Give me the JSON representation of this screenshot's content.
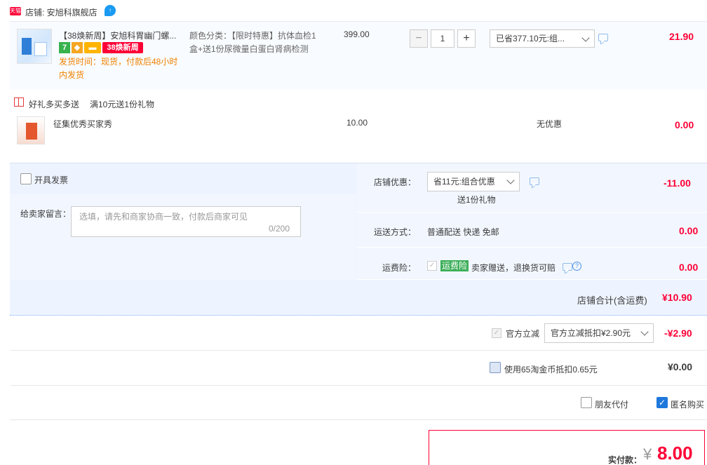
{
  "shop": {
    "badge": "天猫",
    "name": "店铺: 安旭科旗舰店",
    "ww": "↑"
  },
  "item": {
    "title": "【38焕新周】安旭科胃幽门螺...",
    "badges": {
      "seven": "7",
      "shield": "◆",
      "card": "▬",
      "promo": "38焕新周"
    },
    "ship_time": "发货时间：现货，付款后48小时内发货",
    "sku": "颜色分类：【限时特惠】抗体血检1盒+送1份尿微量白蛋白肾病检测",
    "price": "399.00",
    "qty": "1",
    "qty_minus": "−",
    "qty_plus": "+",
    "discount_select": "已省377.10元:组...",
    "subtotal": "21.90"
  },
  "gift": {
    "label": "好礼多买多送",
    "promo": "满10元送1份礼物",
    "title": "征集优秀买家秀",
    "price": "10.00",
    "no_discount": "无优惠",
    "subtotal": "0.00"
  },
  "order": {
    "invoice_label": "开具发票",
    "message_label": "给卖家留言：",
    "message_placeholder": "选填，请先和商家协商一致，付款后商家可见",
    "message_count": "0/200",
    "shop_discount_label": "店铺优惠：",
    "shop_discount_select": "省11元:组合优惠",
    "shop_discount_gift": "送1份礼物",
    "shop_discount_amount": "-11.00",
    "shipping_label": "运送方式：",
    "shipping_method": "普通配送 快递 免邮",
    "shipping_amount": "0.00",
    "insurance_label": "运费险：",
    "insurance_tag": "运费险",
    "insurance_text": "卖家赠送，退换货可赔",
    "insurance_amount": "0.00",
    "shop_total_label": "店铺合计(含运费)",
    "shop_total_amount": "¥10.90"
  },
  "summary": {
    "official_label": "官方立减",
    "official_select": "官方立减抵扣¥2.90元",
    "official_amount": "-¥2.90",
    "coin_label": "使用65淘金币抵扣0.65元",
    "coin_amount": "¥0.00",
    "friend_pay_label": "朋友代付",
    "anonymous_label": "匿名购买",
    "check_mark": "✓",
    "pay_label": "实付款：",
    "pay_yen": "¥",
    "pay_amount": "8.00"
  },
  "colors": {
    "accent_red": "#ff0036",
    "panel_blue": "#eef4ff",
    "link_blue": "#1e78dc"
  }
}
